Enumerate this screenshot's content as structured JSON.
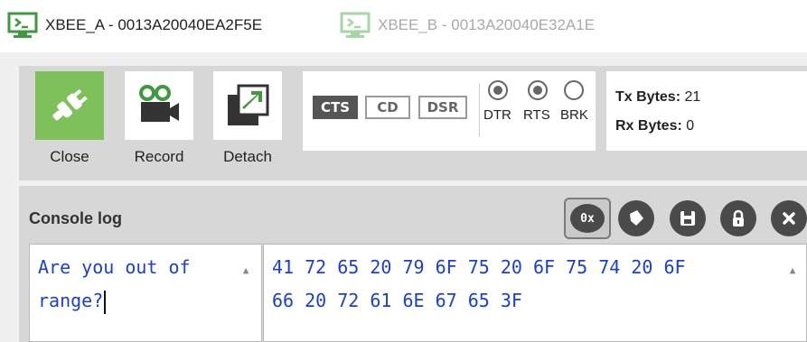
{
  "tabs": [
    {
      "label": "XBEE_A - 0013A20040EA2F5E",
      "active": true,
      "icon": "terminal-icon"
    },
    {
      "label": "XBEE_B - 0013A20040E32A1E",
      "active": false,
      "icon": "terminal-icon"
    }
  ],
  "toolbar": {
    "close_label": "Close",
    "record_label": "Record",
    "detach_label": "Detach",
    "accent_color": "#7ec05a"
  },
  "lines": {
    "cts": "CTS",
    "cd": "CD",
    "dsr": "DSR",
    "cts_on": true,
    "cd_on": false,
    "dsr_on": false,
    "dtr": "DTR",
    "rts": "RTS",
    "brk": "BRK",
    "dtr_on": true,
    "rts_on": true,
    "brk_on": false
  },
  "bytes": {
    "tx_label": "Tx Bytes:",
    "tx_value": "21",
    "rx_label": "Rx Bytes:",
    "rx_value": "0"
  },
  "console": {
    "title": "Console log",
    "hex_button": "0x",
    "ascii_text": "Are you out of\nrange?",
    "hex_text": "41 72 65 20 79 6F 75 20 6F 75 74 20 6F\n66 20 72 61 6E 67 65 3F",
    "text_color": "#1a3fd6"
  }
}
